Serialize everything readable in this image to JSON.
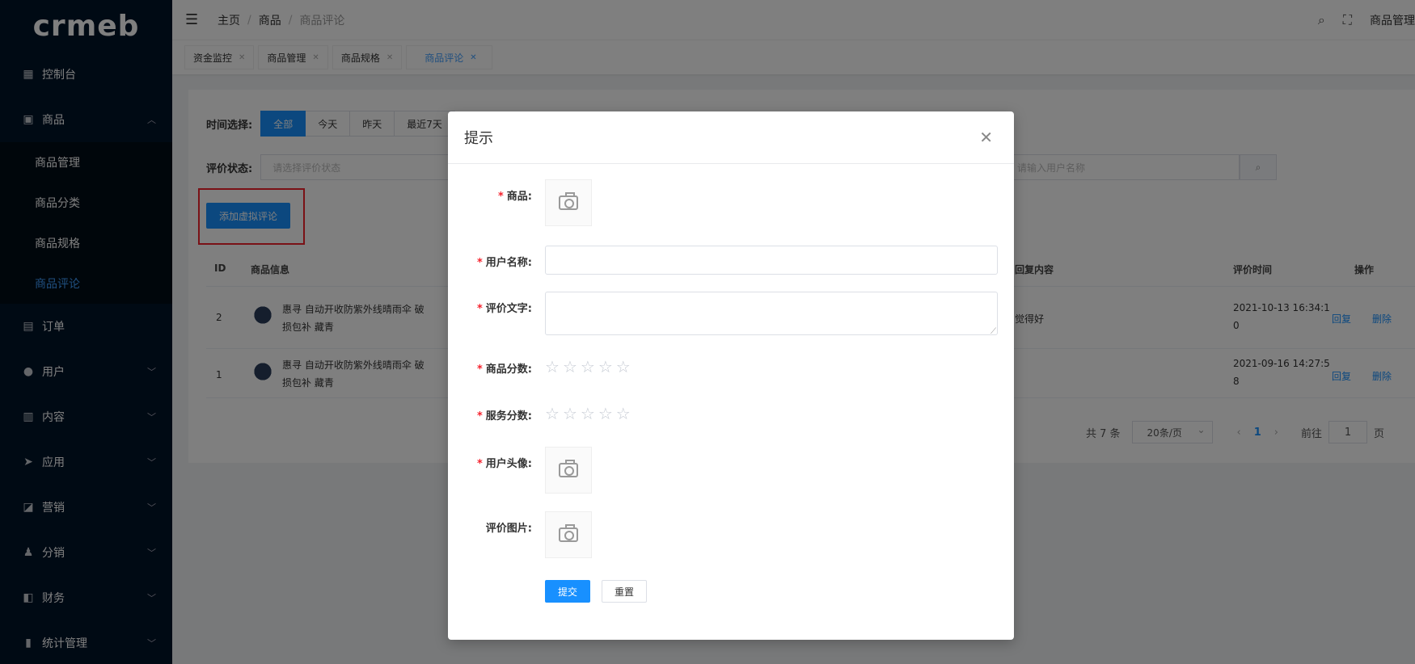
{
  "logo": {
    "text": "crmeb"
  },
  "sidebar": {
    "items": [
      {
        "label": "控制台",
        "icon": "dashboard-icon"
      },
      {
        "label": "商品",
        "icon": "shopping-bag-icon",
        "expanded": true,
        "children": [
          {
            "label": "商品管理"
          },
          {
            "label": "商品分类"
          },
          {
            "label": "商品规格"
          },
          {
            "label": "商品评论",
            "active": true
          }
        ]
      },
      {
        "label": "订单",
        "icon": "clipboard-icon"
      },
      {
        "label": "用户",
        "icon": "user-icon"
      },
      {
        "label": "内容",
        "icon": "content-icon"
      },
      {
        "label": "应用",
        "icon": "send-icon"
      },
      {
        "label": "营销",
        "icon": "chart-icon"
      },
      {
        "label": "分销",
        "icon": "distribution-icon"
      },
      {
        "label": "财务",
        "icon": "wallet-icon"
      },
      {
        "label": "统计管理",
        "icon": "bar-chart-icon"
      }
    ]
  },
  "header": {
    "breadcrumb": [
      "主页",
      "商品",
      "商品评论"
    ],
    "user": "商品管理"
  },
  "tags": [
    {
      "label": "资金监控"
    },
    {
      "label": "商品管理"
    },
    {
      "label": "商品规格"
    },
    {
      "label": "商品评论",
      "active": true
    }
  ],
  "filters": {
    "time_label": "时间选择:",
    "time_options": [
      "全部",
      "今天",
      "昨天",
      "最近7天"
    ],
    "status_label": "评价状态:",
    "status_placeholder": "请选择评价状态",
    "user_placeholder": "请输入用户名称"
  },
  "add_button": "添加虚拟评论",
  "table": {
    "headers": {
      "id": "ID",
      "product": "商品信息",
      "reply": "回复内容",
      "time": "评价时间",
      "actions": "操作"
    },
    "rows": [
      {
        "id": "2",
        "product_l1": "惠寻 自动开收防紫外线晴雨伞 破",
        "product_l2": "损包补 藏青",
        "reply": "觉得好",
        "time_l1": "2021-10-13 16:34:1",
        "time_l2": "0",
        "reply_action": "回复",
        "delete_action": "删除"
      },
      {
        "id": "1",
        "product_l1": "惠寻 自动开收防紫外线晴雨伞 破",
        "product_l2": "损包补 藏青",
        "reply": "",
        "time_l1": "2021-09-16 14:27:5",
        "time_l2": "8",
        "reply_action": "回复",
        "delete_action": "删除"
      }
    ]
  },
  "pagination": {
    "total": "共 7 条",
    "page_size": "20条/页",
    "current": "1",
    "goto_label": "前往",
    "goto_value": "1",
    "page_suffix": "页"
  },
  "modal": {
    "title": "提示",
    "fields": {
      "product": "商品:",
      "username": "用户名称:",
      "comment": "评价文字:",
      "product_score": "商品分数:",
      "service_score": "服务分数:",
      "avatar": "用户头像:",
      "images": "评价图片:"
    },
    "required_mark": "*",
    "product_score": 0,
    "service_score": 0,
    "submit": "提交",
    "reset": "重置"
  }
}
